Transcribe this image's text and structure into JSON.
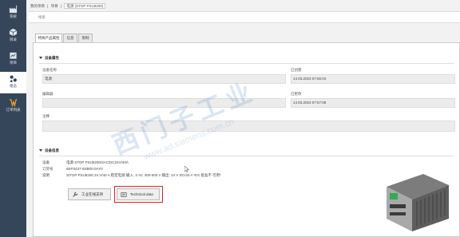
{
  "sidebar": {
    "items": [
      {
        "label": "系统",
        "icon": "factory-icon"
      },
      {
        "label": "目录",
        "icon": "box-icon"
      },
      {
        "label": "项目",
        "icon": "folder-icon"
      },
      {
        "label": "组态",
        "icon": "devices-icon"
      },
      {
        "label": "订单列表",
        "icon": "order-icon"
      }
    ],
    "active_index": 3
  },
  "breadcrumb": [
    "我的项目",
    "项目",
    "电源 (STOP PSU8200)"
  ],
  "search": {
    "placeholder": "搜索"
  },
  "tabs": [
    {
      "label": "特殊产品属性"
    },
    {
      "label": "信息"
    },
    {
      "label": "限制"
    }
  ],
  "device_properties": {
    "title": "设备属性",
    "fields": {
      "name_label": "设备名称",
      "name_value": "电源",
      "created_label": "已创建",
      "created_value": "14.03.2023 07:56:04",
      "editor_label": "编辑器",
      "editor_value": "",
      "modified_label": "已更改",
      "modified_value": "14.03.2023 07:57:08",
      "comment_label": "注释",
      "comment_value": ""
    }
  },
  "device_info": {
    "title": "设备信息",
    "rows": [
      {
        "key": "设备",
        "value": "电源 STOP PSU8200/3AC/DC24V/40A"
      },
      {
        "key": "订货号",
        "value": "6EP3437-8SB00-0AY0"
      },
      {
        "key": "说明",
        "value": "SITOP PSU8200 24 V/40 A 稳定电源 输入: 3 AC 400-500 V 输出: 24 V DC/40 A *EX 批准不 可用*"
      }
    ],
    "buttons": {
      "support_label": "工业在线支持",
      "technical_label": "Technical data"
    }
  },
  "watermark": {
    "cn": "西门子工业",
    "en": "www.ad.siemens.com.cn"
  },
  "colors": {
    "sidebar_bg": "#35465a",
    "highlight": "#e02020"
  }
}
